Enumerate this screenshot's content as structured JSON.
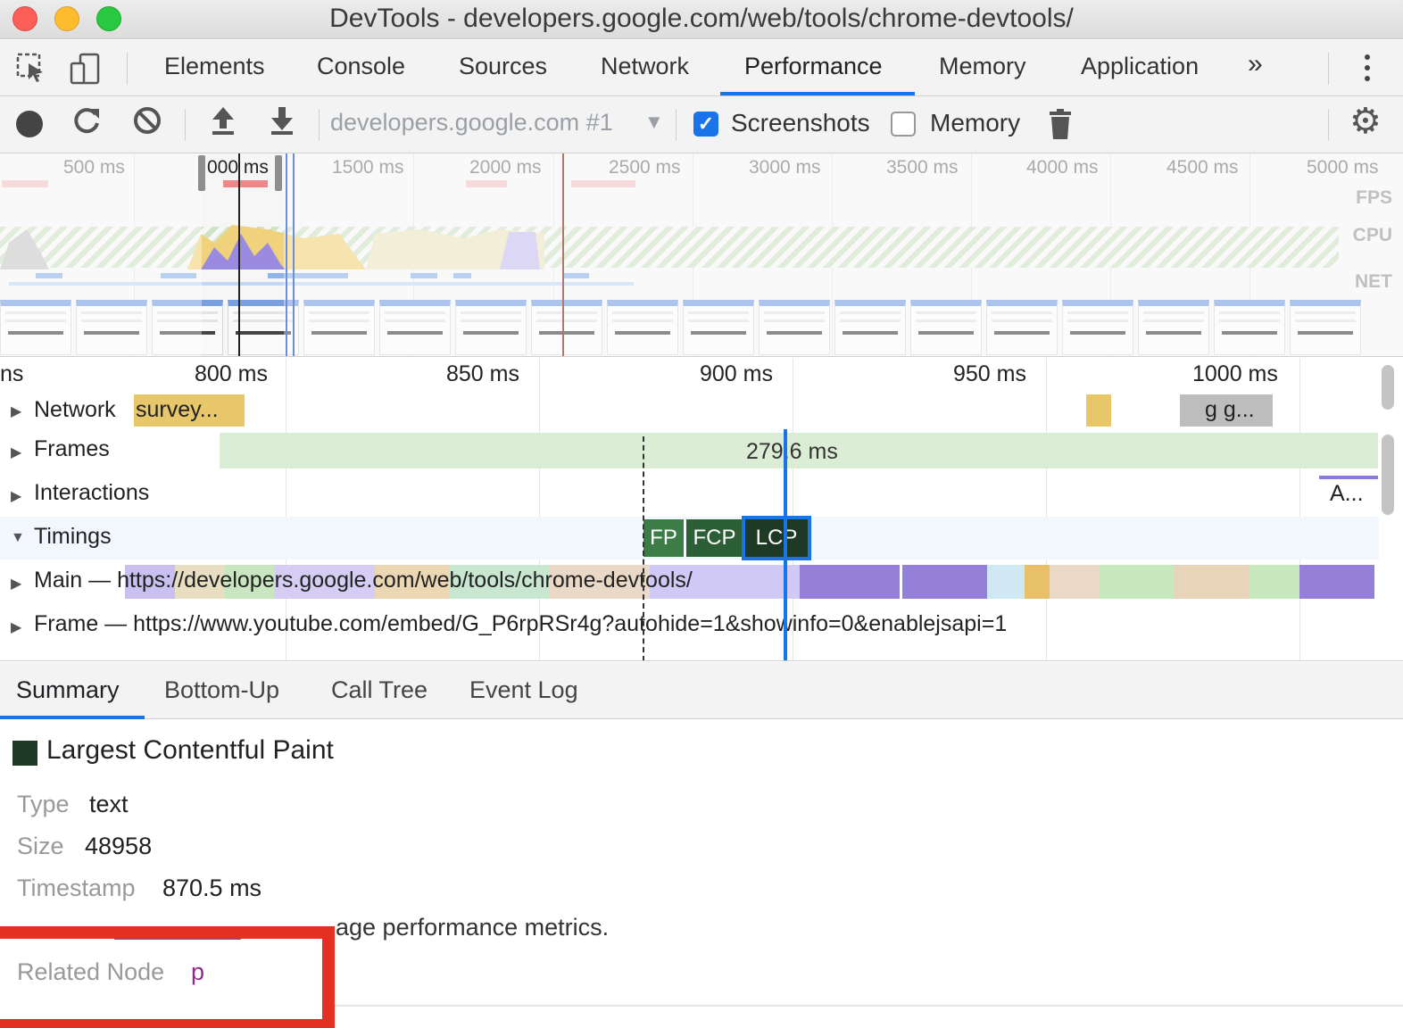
{
  "window": {
    "title": "DevTools - developers.google.com/web/tools/chrome-devtools/"
  },
  "main_tabs": [
    {
      "label": "Elements"
    },
    {
      "label": "Console"
    },
    {
      "label": "Sources"
    },
    {
      "label": "Network"
    },
    {
      "label": "Performance",
      "active": true
    },
    {
      "label": "Memory"
    },
    {
      "label": "Application"
    }
  ],
  "toolbar": {
    "recording_select": "developers.google.com #1",
    "screenshots_label": "Screenshots",
    "screenshots_checked": true,
    "memory_label": "Memory",
    "memory_checked": false
  },
  "overview": {
    "ticks": [
      "500 ms",
      "000 ms",
      "1500 ms",
      "2000 ms",
      "2500 ms",
      "3000 ms",
      "3500 ms",
      "4000 ms",
      "4500 ms",
      "5000 ms"
    ],
    "labels": {
      "fps": "FPS",
      "cpu": "CPU",
      "net": "NET"
    }
  },
  "flame": {
    "ticks": [
      "ns",
      "800 ms",
      "850 ms",
      "900 ms",
      "950 ms",
      "1000 ms"
    ],
    "tracks": {
      "network": "Network",
      "network_bar_label": "survey...",
      "network_bar2_label": "g g...",
      "frames": "Frames",
      "frame_duration": "279.6 ms",
      "interactions": "Interactions",
      "interactions_item": "A...",
      "timings": "Timings",
      "main": "Main — https://developers.google.com/web/tools/chrome-devtools/",
      "frame": "Frame — https://www.youtube.com/embed/G_P6rpRSr4g?autohide=1&showinfo=0&enablejsapi=1"
    },
    "markers": {
      "fp": "FP",
      "fcp": "FCP",
      "lcp": "LCP"
    }
  },
  "bottom_tabs": [
    {
      "label": "Summary",
      "active": true
    },
    {
      "label": "Bottom-Up"
    },
    {
      "label": "Call Tree"
    },
    {
      "label": "Event Log"
    }
  ],
  "summary": {
    "title": "Largest Contentful Paint",
    "swatch_color": "#1e3a24",
    "type_key": "Type",
    "type_val": "text",
    "size_key": "Size",
    "size_val": "48958",
    "ts_key": "Timestamp",
    "ts_val": "870.5 ms",
    "note": "age performance metrics.",
    "related_key": "Related Node",
    "related_val": "p"
  },
  "colors": {
    "accent": "#1a73e8",
    "highlight_box": "#e53124"
  }
}
